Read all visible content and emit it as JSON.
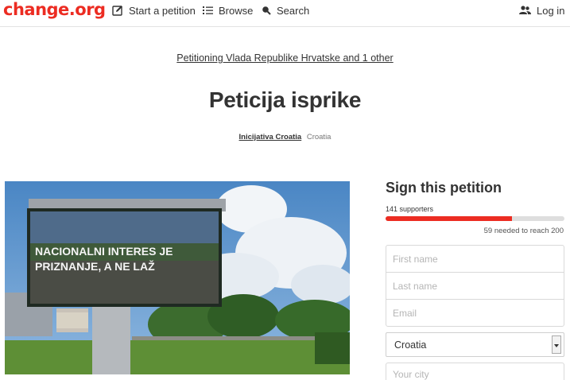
{
  "header": {
    "logo": "change.org",
    "nav": {
      "start": "Start a petition",
      "browse": "Browse",
      "search": "Search",
      "login": "Log in"
    }
  },
  "petition": {
    "target": "Petitioning Vlada Republike Hrvatske and 1 other",
    "title": "Peticija isprike",
    "author_name": "Inicijativa Croatia",
    "author_location": "Croatia",
    "photo_billboard_text": "NACIONALNI INTERES JE PRIZNANJE, A NE LAŽ"
  },
  "sign": {
    "title": "Sign this petition",
    "supporters": "141 supporters",
    "progress_fraction": 0.705,
    "needed": "59 needed to reach 200",
    "fields": {
      "first_name": "First name",
      "last_name": "Last name",
      "email": "Email",
      "country": "Croatia",
      "city": "Your city"
    }
  },
  "colors": {
    "brand": "#ec2c22",
    "text": "#333333"
  }
}
